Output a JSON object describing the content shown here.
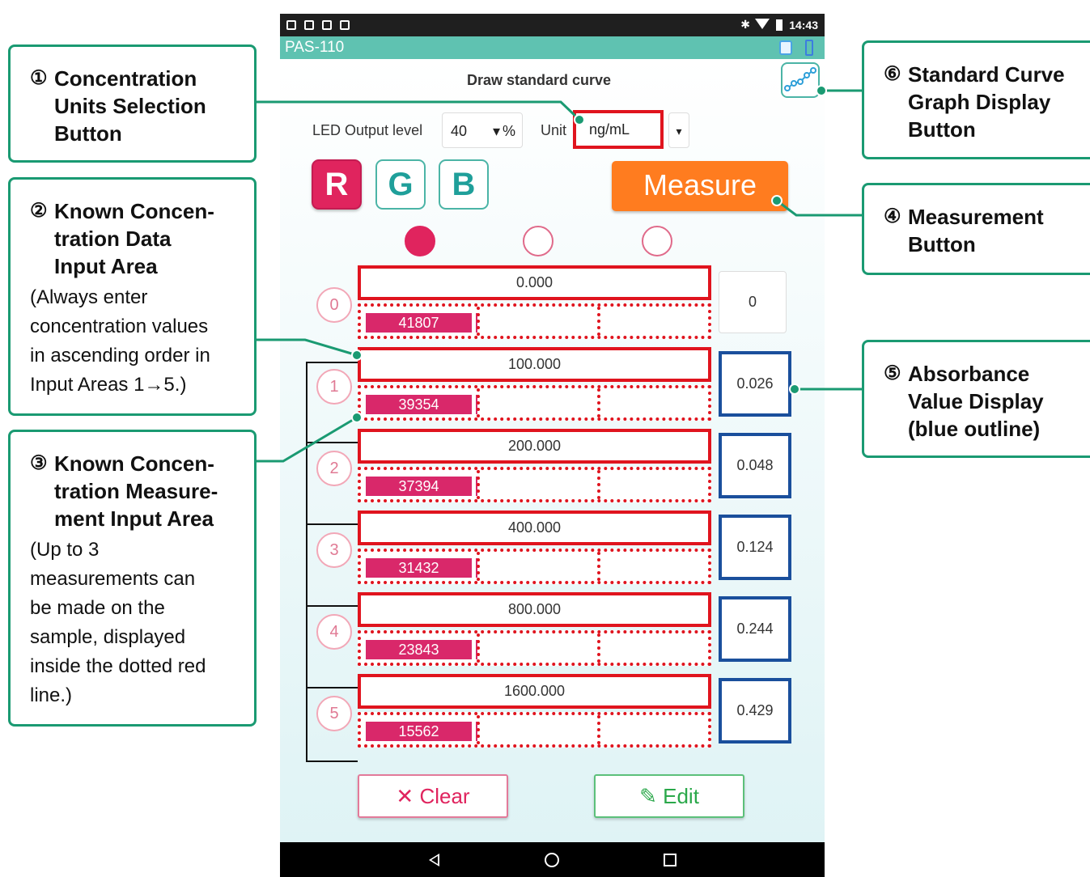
{
  "callouts": {
    "c1": {
      "num": "①",
      "title": "Concentration\nUnits Selection\nButton"
    },
    "c2": {
      "num": "②",
      "title": "Known Concen-\ntration Data\nInput Area",
      "desc": "(Always enter\nconcentration values\nin ascending order in\nInput Areas 1→5.)"
    },
    "c3": {
      "num": "③",
      "title": "Known Concen-\ntration Measure-\nment Input Area",
      "desc": "(Up to 3\nmeasurements can\nbe made on the\nsample, displayed\ninside the dotted red\nline.)"
    },
    "c4": {
      "num": "④",
      "title": "Measurement\nButton"
    },
    "c5": {
      "num": "⑤",
      "title": "Absorbance\nValue Display\n(blue outline)"
    },
    "c6": {
      "num": "⑥",
      "title": "Standard Curve\nGraph Display\nButton"
    }
  },
  "statusbar": {
    "time": "14:43",
    "bluetooth": "✱"
  },
  "appbar": {
    "title": "PAS-110"
  },
  "screen": {
    "title": "Draw standard curve",
    "led_label": "LED Output level",
    "led_value": "40",
    "led_caret": "▾",
    "led_unit": "%",
    "unit_label": "Unit",
    "unit_value": "ng/mL",
    "unit_caret": "▾",
    "rgb": [
      "R",
      "G",
      "B"
    ],
    "measure_label": "Measure",
    "clear_label": "Clear",
    "clear_icon": "✕",
    "edit_label": "Edit",
    "edit_icon": "✎"
  },
  "rows": [
    {
      "index": "0",
      "concentration": "0.000",
      "measurement": "41807",
      "absorbance": "0"
    },
    {
      "index": "1",
      "concentration": "100.000",
      "measurement": "39354",
      "absorbance": "0.026"
    },
    {
      "index": "2",
      "concentration": "200.000",
      "measurement": "37394",
      "absorbance": "0.048"
    },
    {
      "index": "3",
      "concentration": "400.000",
      "measurement": "31432",
      "absorbance": "0.124"
    },
    {
      "index": "4",
      "concentration": "800.000",
      "measurement": "23843",
      "absorbance": "0.244"
    },
    {
      "index": "5",
      "concentration": "1600.000",
      "measurement": "15562",
      "absorbance": "0.429"
    }
  ],
  "colors": {
    "accent_green": "#1a9a72",
    "red_outline": "#e0141e",
    "blue_outline": "#1a4f9c",
    "measure_orange": "#ff7c1f",
    "pink": "#e0245e"
  }
}
